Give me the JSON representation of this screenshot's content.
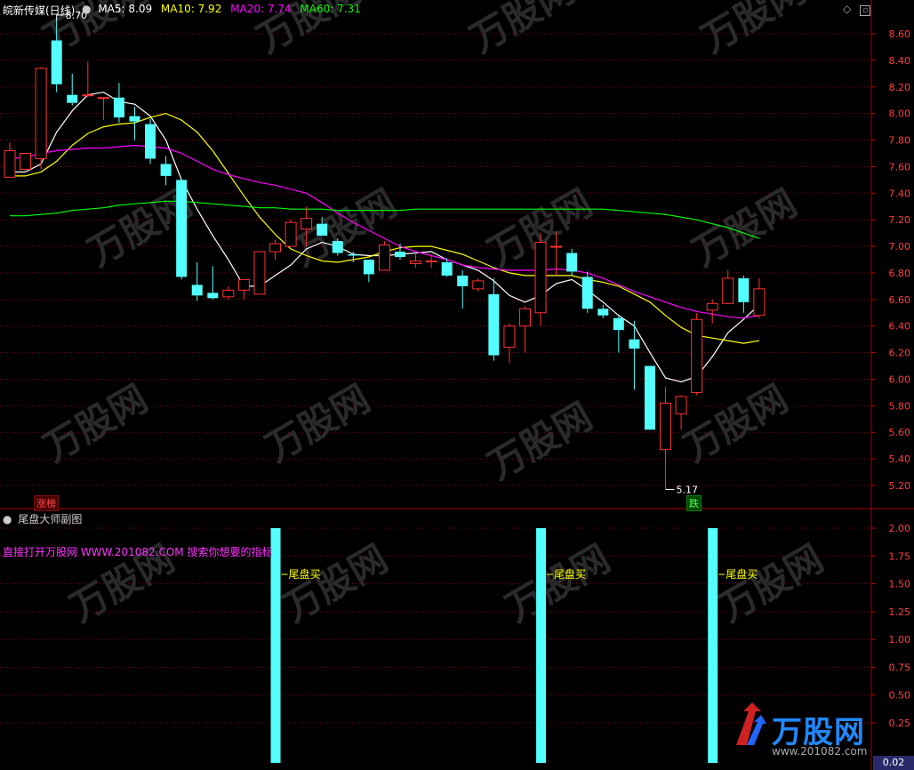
{
  "main_panel": {
    "title": "皖新传媒(日线)",
    "ma_labels": [
      {
        "text": "MA5: 8.09",
        "color": "#ffffff"
      },
      {
        "text": "MA10: 7.92",
        "color": "#ffff00"
      },
      {
        "text": "MA20: 7.74",
        "color": "#ff00ff"
      },
      {
        "text": "MA60: 7.31",
        "color": "#00ff00"
      }
    ],
    "high_marker": "8.70",
    "low_marker": "5.17",
    "tag_up": "涨榜",
    "tag_down": "跌"
  },
  "sub_panel": {
    "title": "尾盘大师副图",
    "ad_text": "直接打开万股网 WWW.201082.COM 搜索你想要的指标",
    "signal_label": "尾盘买"
  },
  "watermark": {
    "brand": "万股网",
    "url": "www.201082.com"
  },
  "corner_value": "0.02",
  "colors": {
    "up": "#ff3232",
    "down": "#54ffff",
    "ma5": "#ffffff",
    "ma10": "#ffff00",
    "ma20": "#ff00ff",
    "ma60": "#00ff00",
    "grid": "#8b0000"
  },
  "chart_data": [
    {
      "type": "candlestick",
      "ylim": [
        5.1,
        8.75
      ],
      "yticks": [
        8.6,
        8.4,
        8.2,
        8.0,
        7.8,
        7.6,
        7.4,
        7.2,
        7.0,
        6.8,
        6.6,
        6.4,
        6.2,
        6.0,
        5.8,
        5.6,
        5.4,
        5.2
      ],
      "candles": [
        {
          "o": 7.52,
          "h": 7.78,
          "l": 7.52,
          "c": 7.72
        },
        {
          "o": 7.58,
          "h": 7.7,
          "l": 7.56,
          "c": 7.7
        },
        {
          "o": 7.66,
          "h": 8.35,
          "l": 7.58,
          "c": 8.34
        },
        {
          "o": 8.55,
          "h": 8.7,
          "l": 8.16,
          "c": 8.22
        },
        {
          "o": 8.14,
          "h": 8.3,
          "l": 8.06,
          "c": 8.08
        },
        {
          "o": 8.14,
          "h": 8.39,
          "l": 8.12,
          "c": 8.14
        },
        {
          "o": 8.12,
          "h": 8.12,
          "l": 7.95,
          "c": 8.12
        },
        {
          "o": 8.12,
          "h": 8.23,
          "l": 7.93,
          "c": 7.97
        },
        {
          "o": 7.98,
          "h": 8.05,
          "l": 7.8,
          "c": 7.94
        },
        {
          "o": 7.92,
          "h": 7.96,
          "l": 7.62,
          "c": 7.66
        },
        {
          "o": 7.62,
          "h": 7.68,
          "l": 7.46,
          "c": 7.53
        },
        {
          "o": 7.5,
          "h": 7.5,
          "l": 6.75,
          "c": 6.77
        },
        {
          "o": 6.71,
          "h": 6.88,
          "l": 6.59,
          "c": 6.63
        },
        {
          "o": 6.65,
          "h": 6.85,
          "l": 6.6,
          "c": 6.61
        },
        {
          "o": 6.62,
          "h": 6.7,
          "l": 6.6,
          "c": 6.67
        },
        {
          "o": 6.67,
          "h": 6.75,
          "l": 6.6,
          "c": 6.75
        },
        {
          "o": 6.64,
          "h": 6.96,
          "l": 6.64,
          "c": 6.96
        },
        {
          "o": 6.96,
          "h": 7.05,
          "l": 6.9,
          "c": 7.02
        },
        {
          "o": 7.0,
          "h": 7.2,
          "l": 7.0,
          "c": 7.18
        },
        {
          "o": 7.13,
          "h": 7.3,
          "l": 7.0,
          "c": 7.21
        },
        {
          "o": 7.17,
          "h": 7.22,
          "l": 7.08,
          "c": 7.08
        },
        {
          "o": 7.04,
          "h": 7.06,
          "l": 6.93,
          "c": 6.95
        },
        {
          "o": 6.94,
          "h": 6.96,
          "l": 6.88,
          "c": 6.93
        },
        {
          "o": 6.9,
          "h": 6.9,
          "l": 6.73,
          "c": 6.79
        },
        {
          "o": 6.82,
          "h": 7.04,
          "l": 6.82,
          "c": 7.01
        },
        {
          "o": 6.96,
          "h": 7.02,
          "l": 6.9,
          "c": 6.92
        },
        {
          "o": 6.87,
          "h": 6.95,
          "l": 6.84,
          "c": 6.89
        },
        {
          "o": 6.89,
          "h": 6.94,
          "l": 6.84,
          "c": 6.89
        },
        {
          "o": 6.88,
          "h": 6.91,
          "l": 6.77,
          "c": 6.78
        },
        {
          "o": 6.78,
          "h": 6.82,
          "l": 6.53,
          "c": 6.7
        },
        {
          "o": 6.68,
          "h": 6.76,
          "l": 6.66,
          "c": 6.74
        },
        {
          "o": 6.64,
          "h": 6.76,
          "l": 6.14,
          "c": 6.18
        },
        {
          "o": 6.24,
          "h": 6.42,
          "l": 6.12,
          "c": 6.4
        },
        {
          "o": 6.4,
          "h": 6.55,
          "l": 6.2,
          "c": 6.53
        },
        {
          "o": 6.5,
          "h": 7.1,
          "l": 6.4,
          "c": 7.03
        },
        {
          "o": 7.0,
          "h": 7.11,
          "l": 6.78,
          "c": 7.0
        },
        {
          "o": 6.95,
          "h": 6.98,
          "l": 6.78,
          "c": 6.81
        },
        {
          "o": 6.77,
          "h": 6.81,
          "l": 6.5,
          "c": 6.53
        },
        {
          "o": 6.53,
          "h": 6.56,
          "l": 6.46,
          "c": 6.48
        },
        {
          "o": 6.46,
          "h": 6.48,
          "l": 6.2,
          "c": 6.37
        },
        {
          "o": 6.3,
          "h": 6.44,
          "l": 5.92,
          "c": 6.23
        },
        {
          "o": 6.1,
          "h": 6.1,
          "l": 5.62,
          "c": 5.62
        },
        {
          "o": 5.47,
          "h": 5.94,
          "l": 5.17,
          "c": 5.82
        },
        {
          "o": 5.74,
          "h": 5.88,
          "l": 5.62,
          "c": 5.87
        },
        {
          "o": 5.9,
          "h": 6.5,
          "l": 5.88,
          "c": 6.45
        },
        {
          "o": 6.52,
          "h": 6.6,
          "l": 6.42,
          "c": 6.57
        },
        {
          "o": 6.57,
          "h": 6.82,
          "l": 6.57,
          "c": 6.76
        },
        {
          "o": 6.76,
          "h": 6.78,
          "l": 6.5,
          "c": 6.58
        },
        {
          "o": 6.48,
          "h": 6.76,
          "l": 6.46,
          "c": 6.68
        }
      ],
      "ma_lines": [
        {
          "name": "MA5",
          "color": "#ffffff",
          "values": [
            7.56,
            7.56,
            7.62,
            7.86,
            8.02,
            8.14,
            8.16,
            8.09,
            8.07,
            7.98,
            7.8,
            7.5,
            7.28,
            7.08,
            6.9,
            6.7,
            6.7,
            6.78,
            6.86,
            6.98,
            7.03,
            7.0,
            6.94,
            6.93,
            6.93,
            6.94,
            6.95,
            6.96,
            6.9,
            6.86,
            6.82,
            6.74,
            6.63,
            6.58,
            6.63,
            6.72,
            6.75,
            6.67,
            6.58,
            6.48,
            6.4,
            6.2,
            6.01,
            5.98,
            6.02,
            6.17,
            6.35,
            6.45,
            6.56
          ]
        },
        {
          "name": "MA10",
          "color": "#ffff00",
          "values": [
            7.53,
            7.53,
            7.56,
            7.64,
            7.76,
            7.85,
            7.9,
            7.92,
            7.93,
            7.97,
            8.0,
            7.95,
            7.86,
            7.72,
            7.55,
            7.38,
            7.22,
            7.09,
            6.98,
            6.93,
            6.89,
            6.88,
            6.9,
            6.92,
            6.96,
            6.99,
            7.0,
            7.0,
            6.97,
            6.94,
            6.89,
            6.84,
            6.8,
            6.78,
            6.78,
            6.78,
            6.78,
            6.75,
            6.73,
            6.7,
            6.64,
            6.58,
            6.48,
            6.39,
            6.33,
            6.31,
            6.29,
            6.27,
            6.29
          ]
        },
        {
          "name": "MA20",
          "color": "#ff00ff",
          "values": [
            7.66,
            7.67,
            7.7,
            7.72,
            7.73,
            7.74,
            7.74,
            7.75,
            7.76,
            7.75,
            7.74,
            7.7,
            7.64,
            7.58,
            7.54,
            7.51,
            7.48,
            7.46,
            7.43,
            7.4,
            7.33,
            7.25,
            7.18,
            7.12,
            7.06,
            7.0,
            6.96,
            6.93,
            6.9,
            6.86,
            6.84,
            6.83,
            6.82,
            6.82,
            6.82,
            6.83,
            6.82,
            6.8,
            6.76,
            6.71,
            6.66,
            6.62,
            6.58,
            6.54,
            6.51,
            6.49,
            6.47,
            6.46,
            6.48
          ]
        },
        {
          "name": "MA60",
          "color": "#00ff00",
          "values": [
            7.23,
            7.23,
            7.24,
            7.25,
            7.27,
            7.28,
            7.29,
            7.31,
            7.32,
            7.33,
            7.34,
            7.34,
            7.33,
            7.32,
            7.31,
            7.3,
            7.29,
            7.29,
            7.28,
            7.28,
            7.28,
            7.27,
            7.27,
            7.27,
            7.27,
            7.27,
            7.28,
            7.28,
            7.28,
            7.28,
            7.28,
            7.28,
            7.28,
            7.28,
            7.28,
            7.28,
            7.28,
            7.28,
            7.28,
            7.27,
            7.26,
            7.25,
            7.24,
            7.22,
            7.2,
            7.17,
            7.14,
            7.1,
            7.06
          ]
        }
      ],
      "annotations": [
        {
          "text": "8.70",
          "candle_index": 3,
          "value": 8.7
        },
        {
          "text": "5.17",
          "candle_index": 42,
          "value": 5.17
        }
      ]
    },
    {
      "type": "bar",
      "ylim": [
        0,
        2.1
      ],
      "yticks": [
        2.0,
        1.75,
        1.5,
        1.25,
        1.0,
        0.75,
        0.5,
        0.25
      ],
      "signals": [
        {
          "candle_index": 17,
          "value": 2.0,
          "label": "尾盘买"
        },
        {
          "candle_index": 34,
          "value": 2.0,
          "label": "尾盘买"
        },
        {
          "candle_index": 45,
          "value": 2.0,
          "label": "尾盘买"
        }
      ]
    }
  ]
}
